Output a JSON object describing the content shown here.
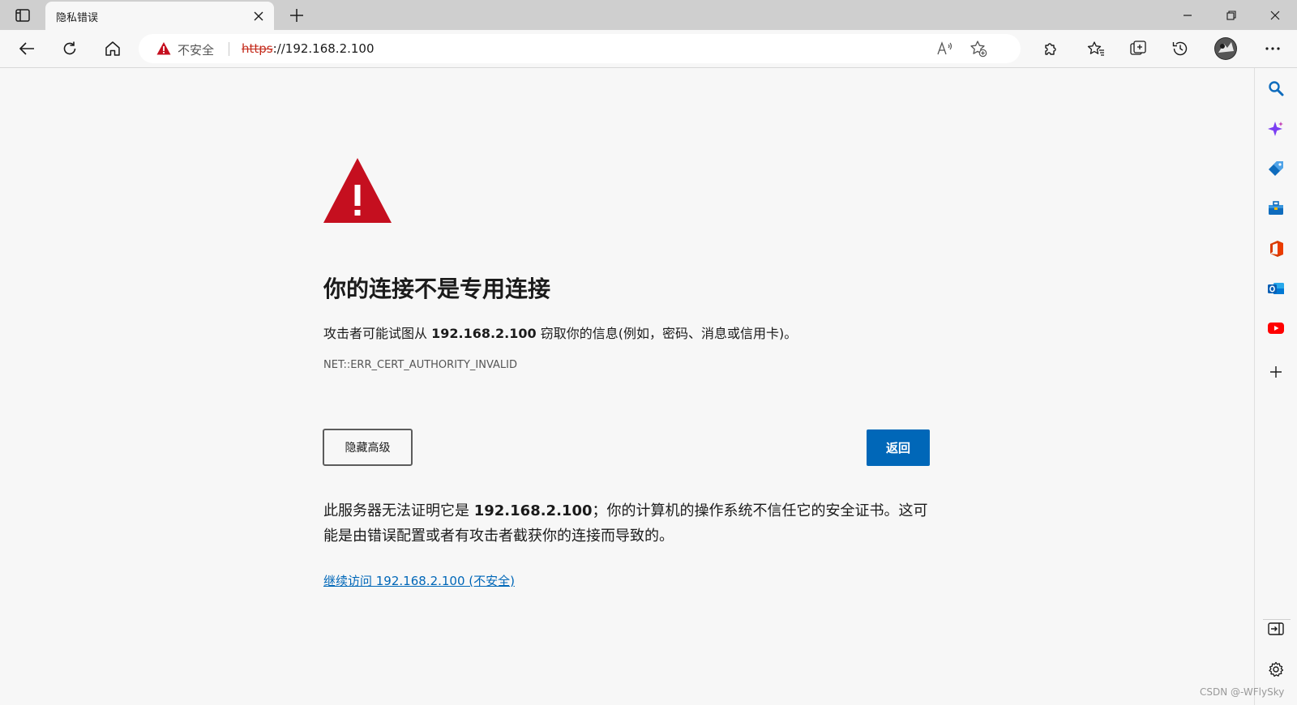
{
  "browser": {
    "tab": {
      "title": "隐私错误"
    },
    "omnibox": {
      "security_label": "不安全",
      "url_protocol": "https",
      "url_rest": "://192.168.2.100"
    }
  },
  "page": {
    "heading": "你的连接不是专用连接",
    "description_prefix": "攻击者可能试图从 ",
    "description_host": "192.168.2.100",
    "description_suffix": " 窃取你的信息(例如，密码、消息或信用卡)。",
    "error_code": "NET::ERR_CERT_AUTHORITY_INVALID",
    "hide_advanced_label": "隐藏高级",
    "back_label": "返回",
    "detail_prefix": "此服务器无法证明它是 ",
    "detail_host": "192.168.2.100",
    "detail_suffix": "；你的计算机的操作系统不信任它的安全证书。这可能是由错误配置或者有攻击者截获你的连接而导致的。",
    "proceed_link": "继续访问 192.168.2.100 (不安全)"
  },
  "watermark": "CSDN @-WFlySky",
  "colors": {
    "accent_blue": "#0067b8",
    "warning_red": "#c50f1f",
    "background": "#f7f7f7"
  }
}
